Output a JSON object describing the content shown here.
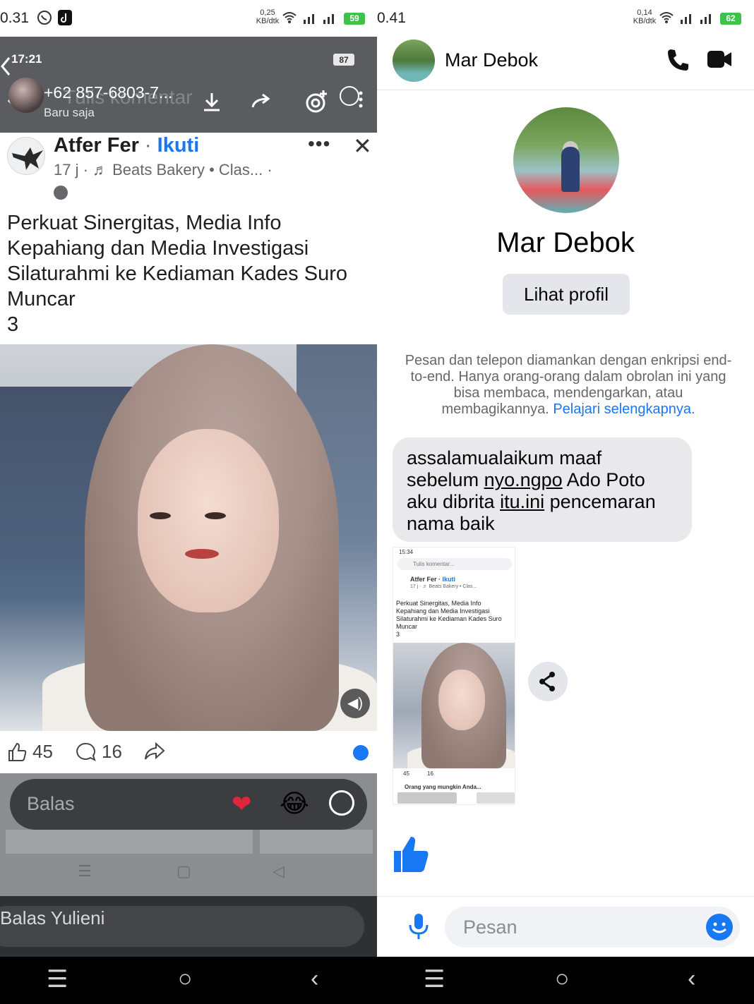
{
  "left": {
    "status": {
      "time": "0.31",
      "net_speed": "0,25",
      "net_unit": "KB/dtk",
      "battery": "59"
    },
    "inner_status": {
      "time": "17:21",
      "battery": "87"
    },
    "chat_header": {
      "contact": "+62 857-6803-7...",
      "status": "Baru saja",
      "ghost_text": "Tulis komentar"
    },
    "post": {
      "author": "Atfer Fer",
      "separator": " · ",
      "follow_label": "Ikuti",
      "meta": "17 j · ♬ Beats Bakery • Clas... ·",
      "caption": "Perkuat Sinergitas, Media Info\nKepahiang dan Media Investigasi\nSilaturahmi ke Kediaman Kades Suro\nMuncar\n3",
      "more": "•••",
      "close": "✕"
    },
    "reactions": {
      "likes": "45",
      "comments": "16"
    },
    "reply_bar": {
      "placeholder": "Balas",
      "heart": "❤",
      "laugh": "😂"
    },
    "bottom_reply": {
      "placeholder": "Balas Yulieni"
    }
  },
  "right": {
    "status": {
      "time": "0.41",
      "net_speed": "0,14",
      "net_unit": "KB/dtk",
      "battery": "62"
    },
    "header": {
      "name": "Mar Debok"
    },
    "profile": {
      "name": "Mar Debok",
      "view_profile_label": "Lihat profil"
    },
    "e2e_notice": {
      "text": "Pesan dan telepon diamankan dengan enkripsi end-to-end. Hanya orang-orang dalam obrolan ini yang bisa membaca, mendengarkan, atau membagikannya.",
      "link": "Pelajari selengkapnya."
    },
    "message": {
      "part1": "assalamualaikum maaf sebelum ",
      "link1": "nyo.ngpo",
      "part2": " Ado Poto aku dibrita ",
      "link2": "itu.ini",
      "part3": " pencemaran nama baik"
    },
    "screenshot_preview": {
      "time": "15:34",
      "comment_placeholder": "Tulis komentar...",
      "author": "Atfer Fer",
      "follow_label": "Ikuti",
      "meta": "17 j · ♬ Beats Bakery • Clas...",
      "caption": "Perkuat Sinergitas, Media Info\nKepahiang dan Media Investigasi\nSilaturahmi ke Kediaman Kades Suro\nMuncar\n3",
      "likes": "45",
      "comments": "16",
      "suggestion": "Orang yang mungkin Anda..."
    },
    "composer": {
      "placeholder": "Pesan"
    }
  },
  "colors": {
    "messenger_blue": "#1877f2",
    "bubble_gray": "#e9e9eb",
    "wa_dark": "#5b5c5f",
    "battery_green": "#3ec34a"
  }
}
